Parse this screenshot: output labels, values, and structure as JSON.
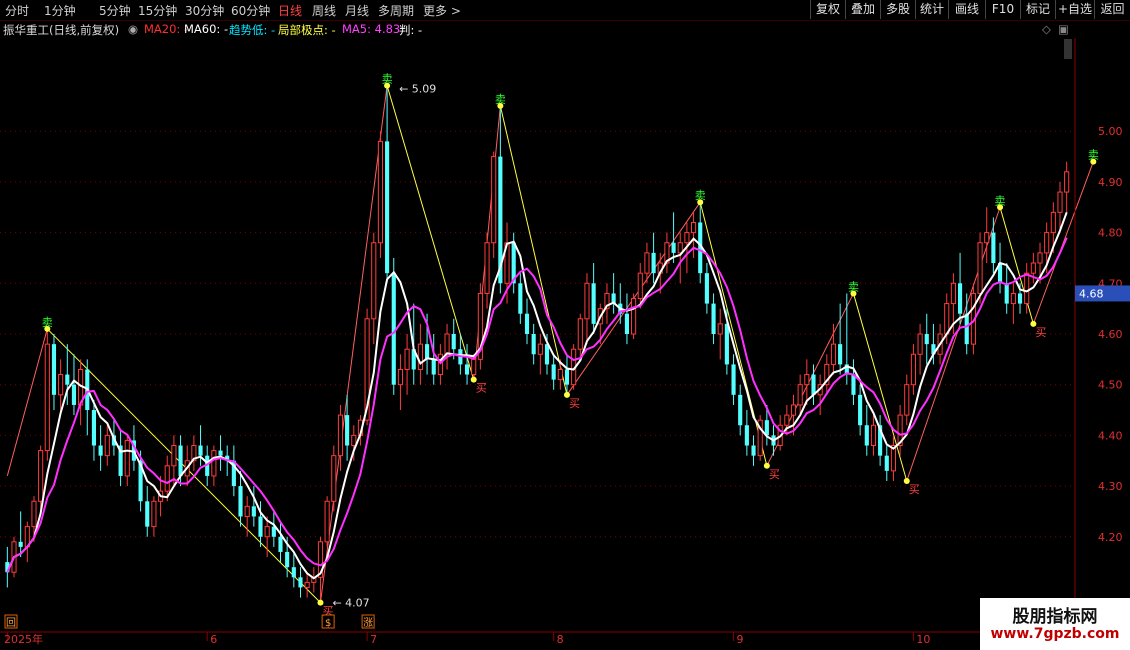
{
  "toolbar": {
    "periods": [
      "分时",
      "1分钟",
      "5分钟",
      "15分钟",
      "30分钟",
      "60分钟",
      "日线",
      "周线",
      "月线",
      "多周期",
      "更多 >"
    ],
    "active_period": "日线",
    "buttons": [
      "复权",
      "叠加",
      "多股",
      "统计",
      "画线",
      "F10",
      "标记",
      "+自选",
      "返回"
    ]
  },
  "info": {
    "title": "振华重工(日线,前复权)",
    "ma20": "MA20: -",
    "ma60": "MA60: -",
    "trend": "趋势低: -",
    "local_extreme": "局部极点: -",
    "ma5": "MA5: 4.83",
    "judge": "判: -",
    "colors": {
      "ma20": "#ff3030",
      "ma60": "#ffffff",
      "trend": "#00e5ff",
      "local": "#ffff40",
      "ma5": "#ff40ff",
      "judge": "#ffffff"
    }
  },
  "chart_data": {
    "type": "candlestick",
    "ylim": [
      4.02,
      5.18
    ],
    "y_ticks": [
      "5.00",
      "4.90",
      "4.80",
      "4.70",
      "4.60",
      "4.50",
      "4.40",
      "4.30",
      "4.20"
    ],
    "current_price": "4.68",
    "x_labels": [
      {
        "label": "2025年",
        "index": 0
      },
      {
        "label": "6",
        "index": 30
      },
      {
        "label": "7",
        "index": 54
      },
      {
        "label": "8",
        "index": 82
      },
      {
        "label": "9",
        "index": 109
      },
      {
        "label": "10",
        "index": 136
      }
    ],
    "markers": [
      {
        "index": 0,
        "text": "回"
      },
      {
        "index": 48,
        "text": "$"
      },
      {
        "index": 54,
        "text": "涨"
      }
    ],
    "annotations": {
      "high": "5.09",
      "low": "4.07",
      "buy": "买",
      "sell": "卖"
    },
    "extremes": [
      {
        "index": 6,
        "type": "sell",
        "price": 4.61
      },
      {
        "index": 47,
        "type": "buy",
        "price": 4.07
      },
      {
        "index": 57,
        "type": "sell",
        "price": 5.09
      },
      {
        "index": 70,
        "type": "buy",
        "price": 4.51
      },
      {
        "index": 74,
        "type": "sell",
        "price": 5.05
      },
      {
        "index": 84,
        "type": "buy",
        "price": 4.48
      },
      {
        "index": 104,
        "type": "sell",
        "price": 4.86
      },
      {
        "index": 114,
        "type": "buy",
        "price": 4.34
      },
      {
        "index": 127,
        "type": "sell",
        "price": 4.68
      },
      {
        "index": 135,
        "type": "buy",
        "price": 4.31
      },
      {
        "index": 149,
        "type": "sell",
        "price": 4.85
      },
      {
        "index": 154,
        "type": "buy",
        "price": 4.62
      },
      {
        "index": 163,
        "type": "sell",
        "price": 4.94
      }
    ],
    "ohlc": [
      [
        4.15,
        4.18,
        4.1,
        4.13
      ],
      [
        4.13,
        4.2,
        4.12,
        4.19
      ],
      [
        4.19,
        4.25,
        4.16,
        4.18
      ],
      [
        4.18,
        4.23,
        4.15,
        4.22
      ],
      [
        4.22,
        4.28,
        4.19,
        4.27
      ],
      [
        4.27,
        4.38,
        4.25,
        4.37
      ],
      [
        4.37,
        4.61,
        4.35,
        4.58
      ],
      [
        4.58,
        4.6,
        4.45,
        4.48
      ],
      [
        4.48,
        4.55,
        4.44,
        4.52
      ],
      [
        4.52,
        4.58,
        4.46,
        4.5
      ],
      [
        4.5,
        4.56,
        4.44,
        4.46
      ],
      [
        4.46,
        4.55,
        4.42,
        4.53
      ],
      [
        4.53,
        4.55,
        4.4,
        4.45
      ],
      [
        4.45,
        4.47,
        4.35,
        4.38
      ],
      [
        4.38,
        4.42,
        4.33,
        4.36
      ],
      [
        4.36,
        4.42,
        4.34,
        4.4
      ],
      [
        4.4,
        4.43,
        4.36,
        4.38
      ],
      [
        4.38,
        4.41,
        4.3,
        4.32
      ],
      [
        4.32,
        4.4,
        4.3,
        4.39
      ],
      [
        4.39,
        4.42,
        4.33,
        4.35
      ],
      [
        4.35,
        4.37,
        4.25,
        4.27
      ],
      [
        4.27,
        4.3,
        4.2,
        4.22
      ],
      [
        4.22,
        4.28,
        4.2,
        4.27
      ],
      [
        4.27,
        4.32,
        4.24,
        4.29
      ],
      [
        4.29,
        4.36,
        4.27,
        4.34
      ],
      [
        4.34,
        4.4,
        4.3,
        4.38
      ],
      [
        4.38,
        4.4,
        4.3,
        4.32
      ],
      [
        4.32,
        4.38,
        4.3,
        4.35
      ],
      [
        4.35,
        4.4,
        4.33,
        4.38
      ],
      [
        4.38,
        4.42,
        4.34,
        4.36
      ],
      [
        4.36,
        4.38,
        4.3,
        4.32
      ],
      [
        4.32,
        4.38,
        4.3,
        4.37
      ],
      [
        4.37,
        4.4,
        4.33,
        4.36
      ],
      [
        4.36,
        4.38,
        4.32,
        4.35
      ],
      [
        4.35,
        4.38,
        4.28,
        4.3
      ],
      [
        4.3,
        4.33,
        4.22,
        4.24
      ],
      [
        4.24,
        4.28,
        4.2,
        4.26
      ],
      [
        4.26,
        4.3,
        4.22,
        4.24
      ],
      [
        4.24,
        4.27,
        4.18,
        4.2
      ],
      [
        4.2,
        4.24,
        4.16,
        4.22
      ],
      [
        4.22,
        4.25,
        4.18,
        4.2
      ],
      [
        4.2,
        4.23,
        4.15,
        4.17
      ],
      [
        4.17,
        4.2,
        4.12,
        4.14
      ],
      [
        4.14,
        4.17,
        4.1,
        4.12
      ],
      [
        4.12,
        4.14,
        4.08,
        4.1
      ],
      [
        4.1,
        4.13,
        4.08,
        4.11
      ],
      [
        4.11,
        4.14,
        4.09,
        4.12
      ],
      [
        4.12,
        4.2,
        4.07,
        4.19
      ],
      [
        4.19,
        4.28,
        4.18,
        4.27
      ],
      [
        4.27,
        4.38,
        4.25,
        4.36
      ],
      [
        4.36,
        4.46,
        4.33,
        4.44
      ],
      [
        4.44,
        4.48,
        4.35,
        4.38
      ],
      [
        4.38,
        4.42,
        4.35,
        4.4
      ],
      [
        4.4,
        4.44,
        4.38,
        4.43
      ],
      [
        4.43,
        4.65,
        4.42,
        4.63
      ],
      [
        4.63,
        4.8,
        4.58,
        4.78
      ],
      [
        4.78,
        5.0,
        4.75,
        4.98
      ],
      [
        4.98,
        5.09,
        4.7,
        4.72
      ],
      [
        4.72,
        4.75,
        4.48,
        4.5
      ],
      [
        4.5,
        4.56,
        4.45,
        4.53
      ],
      [
        4.53,
        4.6,
        4.48,
        4.57
      ],
      [
        4.57,
        4.66,
        4.5,
        4.53
      ],
      [
        4.53,
        4.62,
        4.5,
        4.58
      ],
      [
        4.58,
        4.64,
        4.52,
        4.55
      ],
      [
        4.55,
        4.6,
        4.5,
        4.52
      ],
      [
        4.52,
        4.58,
        4.5,
        4.56
      ],
      [
        4.56,
        4.62,
        4.53,
        4.6
      ],
      [
        4.6,
        4.63,
        4.55,
        4.57
      ],
      [
        4.57,
        4.6,
        4.52,
        4.54
      ],
      [
        4.54,
        4.58,
        4.5,
        4.52
      ],
      [
        4.52,
        4.56,
        4.51,
        4.55
      ],
      [
        4.55,
        4.7,
        4.53,
        4.68
      ],
      [
        4.68,
        4.8,
        4.65,
        4.78
      ],
      [
        4.78,
        4.96,
        4.75,
        4.95
      ],
      [
        4.95,
        5.05,
        4.68,
        4.7
      ],
      [
        4.7,
        4.82,
        4.66,
        4.78
      ],
      [
        4.78,
        4.8,
        4.68,
        4.7
      ],
      [
        4.7,
        4.72,
        4.62,
        4.64
      ],
      [
        4.64,
        4.67,
        4.58,
        4.6
      ],
      [
        4.6,
        4.62,
        4.54,
        4.56
      ],
      [
        4.56,
        4.6,
        4.52,
        4.58
      ],
      [
        4.58,
        4.6,
        4.52,
        4.54
      ],
      [
        4.54,
        4.56,
        4.49,
        4.51
      ],
      [
        4.51,
        4.55,
        4.49,
        4.53
      ],
      [
        4.53,
        4.56,
        4.48,
        4.5
      ],
      [
        4.5,
        4.58,
        4.49,
        4.57
      ],
      [
        4.57,
        4.64,
        4.55,
        4.63
      ],
      [
        4.63,
        4.72,
        4.58,
        4.7
      ],
      [
        4.7,
        4.74,
        4.6,
        4.62
      ],
      [
        4.62,
        4.66,
        4.58,
        4.65
      ],
      [
        4.65,
        4.7,
        4.62,
        4.68
      ],
      [
        4.68,
        4.72,
        4.64,
        4.66
      ],
      [
        4.66,
        4.7,
        4.62,
        4.64
      ],
      [
        4.64,
        4.68,
        4.58,
        4.6
      ],
      [
        4.6,
        4.68,
        4.59,
        4.67
      ],
      [
        4.67,
        4.74,
        4.65,
        4.72
      ],
      [
        4.72,
        4.78,
        4.7,
        4.76
      ],
      [
        4.76,
        4.8,
        4.7,
        4.72
      ],
      [
        4.72,
        4.76,
        4.68,
        4.74
      ],
      [
        4.74,
        4.8,
        4.72,
        4.78
      ],
      [
        4.78,
        4.84,
        4.74,
        4.76
      ],
      [
        4.76,
        4.8,
        4.7,
        4.78
      ],
      [
        4.78,
        4.82,
        4.72,
        4.8
      ],
      [
        4.8,
        4.84,
        4.75,
        4.82
      ],
      [
        4.82,
        4.86,
        4.7,
        4.72
      ],
      [
        4.72,
        4.74,
        4.64,
        4.66
      ],
      [
        4.66,
        4.68,
        4.58,
        4.6
      ],
      [
        4.6,
        4.65,
        4.55,
        4.62
      ],
      [
        4.62,
        4.65,
        4.52,
        4.54
      ],
      [
        4.54,
        4.56,
        4.46,
        4.48
      ],
      [
        4.48,
        4.5,
        4.4,
        4.42
      ],
      [
        4.42,
        4.45,
        4.36,
        4.38
      ],
      [
        4.38,
        4.4,
        4.34,
        4.36
      ],
      [
        4.36,
        4.44,
        4.35,
        4.43
      ],
      [
        4.43,
        4.46,
        4.38,
        4.4
      ],
      [
        4.4,
        4.42,
        4.36,
        4.38
      ],
      [
        4.38,
        4.44,
        4.37,
        4.42
      ],
      [
        4.42,
        4.46,
        4.4,
        4.44
      ],
      [
        4.44,
        4.48,
        4.4,
        4.46
      ],
      [
        4.46,
        4.52,
        4.44,
        4.5
      ],
      [
        4.5,
        4.55,
        4.46,
        4.52
      ],
      [
        4.52,
        4.54,
        4.46,
        4.48
      ],
      [
        4.48,
        4.52,
        4.44,
        4.5
      ],
      [
        4.5,
        4.56,
        4.48,
        4.54
      ],
      [
        4.54,
        4.62,
        4.52,
        4.58
      ],
      [
        4.58,
        4.66,
        4.52,
        4.54
      ],
      [
        4.54,
        4.68,
        4.5,
        4.52
      ],
      [
        4.52,
        4.55,
        4.46,
        4.48
      ],
      [
        4.48,
        4.5,
        4.4,
        4.42
      ],
      [
        4.42,
        4.46,
        4.36,
        4.38
      ],
      [
        4.38,
        4.44,
        4.36,
        4.42
      ],
      [
        4.42,
        4.44,
        4.34,
        4.36
      ],
      [
        4.36,
        4.38,
        4.31,
        4.33
      ],
      [
        4.33,
        4.4,
        4.31,
        4.38
      ],
      [
        4.38,
        4.46,
        4.36,
        4.44
      ],
      [
        4.44,
        4.52,
        4.42,
        4.5
      ],
      [
        4.5,
        4.58,
        4.48,
        4.56
      ],
      [
        4.56,
        4.62,
        4.52,
        4.6
      ],
      [
        4.6,
        4.64,
        4.54,
        4.58
      ],
      [
        4.58,
        4.62,
        4.54,
        4.56
      ],
      [
        4.56,
        4.62,
        4.54,
        4.6
      ],
      [
        4.6,
        4.68,
        4.58,
        4.66
      ],
      [
        4.66,
        4.72,
        4.6,
        4.7
      ],
      [
        4.7,
        4.76,
        4.62,
        4.64
      ],
      [
        4.64,
        4.68,
        4.56,
        4.58
      ],
      [
        4.58,
        4.7,
        4.56,
        4.68
      ],
      [
        4.68,
        4.8,
        4.66,
        4.78
      ],
      [
        4.78,
        4.85,
        4.74,
        4.8
      ],
      [
        4.8,
        4.83,
        4.72,
        4.74
      ],
      [
        4.74,
        4.78,
        4.68,
        4.7
      ],
      [
        4.7,
        4.74,
        4.64,
        4.66
      ],
      [
        4.66,
        4.7,
        4.62,
        4.68
      ],
      [
        4.68,
        4.7,
        4.64,
        4.66
      ],
      [
        4.66,
        4.74,
        4.64,
        4.72
      ],
      [
        4.72,
        4.76,
        4.7,
        4.74
      ],
      [
        4.74,
        4.78,
        4.7,
        4.76
      ],
      [
        4.76,
        4.82,
        4.72,
        4.8
      ],
      [
        4.8,
        4.86,
        4.76,
        4.84
      ],
      [
        4.84,
        4.9,
        4.8,
        4.88
      ],
      [
        4.88,
        4.94,
        4.84,
        4.92
      ]
    ]
  },
  "watermark": {
    "line1": "股朋指标网",
    "line2": "www.7gpzb.com"
  }
}
